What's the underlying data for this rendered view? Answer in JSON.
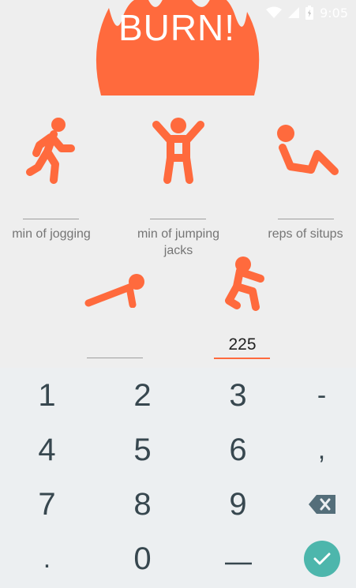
{
  "status_bar": {
    "time": "9:05",
    "icons": [
      "wifi-icon",
      "signal-icon",
      "battery-charging-icon"
    ]
  },
  "app": {
    "title": "BURN!",
    "accent_color": "#ff6a3d"
  },
  "exercises": [
    {
      "name": "jogging",
      "icon": "running-icon",
      "label": "min of jogging",
      "value": ""
    },
    {
      "name": "jumping-jacks",
      "icon": "jumping-jacks-icon",
      "label": "min of jumping jacks",
      "value": ""
    },
    {
      "name": "situps",
      "icon": "situps-icon",
      "label": "reps of situps",
      "value": ""
    },
    {
      "name": "pushups",
      "icon": "pushup-icon",
      "label": "",
      "value": ""
    },
    {
      "name": "squats",
      "icon": "squat-icon",
      "label": "",
      "value": "225"
    }
  ],
  "keyboard": {
    "rows": [
      [
        "1",
        "2",
        "3",
        "-"
      ],
      [
        "4",
        "5",
        "6",
        ","
      ],
      [
        "7",
        "8",
        "9",
        "backspace"
      ],
      [
        ".",
        "0",
        "space",
        "done"
      ]
    ],
    "done_color": "#4db6ac"
  }
}
